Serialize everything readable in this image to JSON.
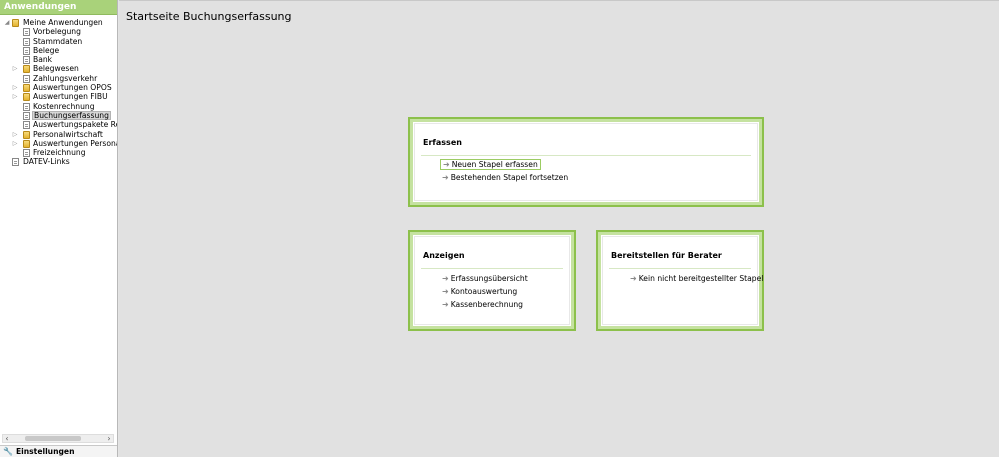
{
  "sidebar": {
    "title": "Anwendungen",
    "tree": [
      {
        "label": "Meine Anwendungen",
        "level": 0,
        "icon": "folder-icon",
        "expander": "expanded"
      },
      {
        "label": "Vorbelegung",
        "level": 1,
        "icon": "document-icon",
        "expander": ""
      },
      {
        "label": "Stammdaten",
        "level": 1,
        "icon": "document-icon",
        "expander": ""
      },
      {
        "label": "Belege",
        "level": 1,
        "icon": "document-icon",
        "expander": ""
      },
      {
        "label": "Bank",
        "level": 1,
        "icon": "document-icon",
        "expander": ""
      },
      {
        "label": "Belegwesen",
        "level": 1,
        "icon": "folder-icon",
        "expander": "collapsed"
      },
      {
        "label": "Zahlungsverkehr",
        "level": 1,
        "icon": "document-icon",
        "expander": ""
      },
      {
        "label": "Auswertungen OPOS",
        "level": 1,
        "icon": "folder-icon",
        "expander": "collapsed"
      },
      {
        "label": "Auswertungen FIBU",
        "level": 1,
        "icon": "folder-icon",
        "expander": "collapsed"
      },
      {
        "label": "Kostenrechnung",
        "level": 1,
        "icon": "document-icon",
        "expander": ""
      },
      {
        "label": "Buchungserfassung",
        "level": 1,
        "icon": "document-icon",
        "expander": "",
        "selected": true
      },
      {
        "label": "Auswertungspakete Rechno",
        "level": 1,
        "icon": "document-icon",
        "expander": ""
      },
      {
        "label": "Personalwirtschaft",
        "level": 1,
        "icon": "folder-icon",
        "expander": "collapsed"
      },
      {
        "label": "Auswertungen Personalwirt",
        "level": 1,
        "icon": "folder-icon",
        "expander": "collapsed"
      },
      {
        "label": "Freizeichnung",
        "level": 1,
        "icon": "document-icon",
        "expander": ""
      },
      {
        "label": "DATEV-Links",
        "level": 0,
        "icon": "document-icon",
        "expander": ""
      }
    ],
    "settings_label": "Einstellungen"
  },
  "main": {
    "title": "Startseite Buchungserfassung",
    "panels": {
      "erfassen": {
        "title": "Erfassen",
        "links": [
          "Neuen Stapel erfassen",
          "Bestehenden Stapel fortsetzen"
        ]
      },
      "anzeigen": {
        "title": "Anzeigen",
        "links": [
          "Erfassungsübersicht",
          "Kontoauswertung",
          "Kassenberechnung"
        ]
      },
      "bereitstellen": {
        "title": "Bereitstellen für Berater",
        "links": [
          "Kein nicht bereitgestellter Stapel"
        ]
      }
    }
  },
  "colors": {
    "header_green": "#a9d27a",
    "panel_border_green": "#8cc04b",
    "background": "#e1e1e1"
  }
}
